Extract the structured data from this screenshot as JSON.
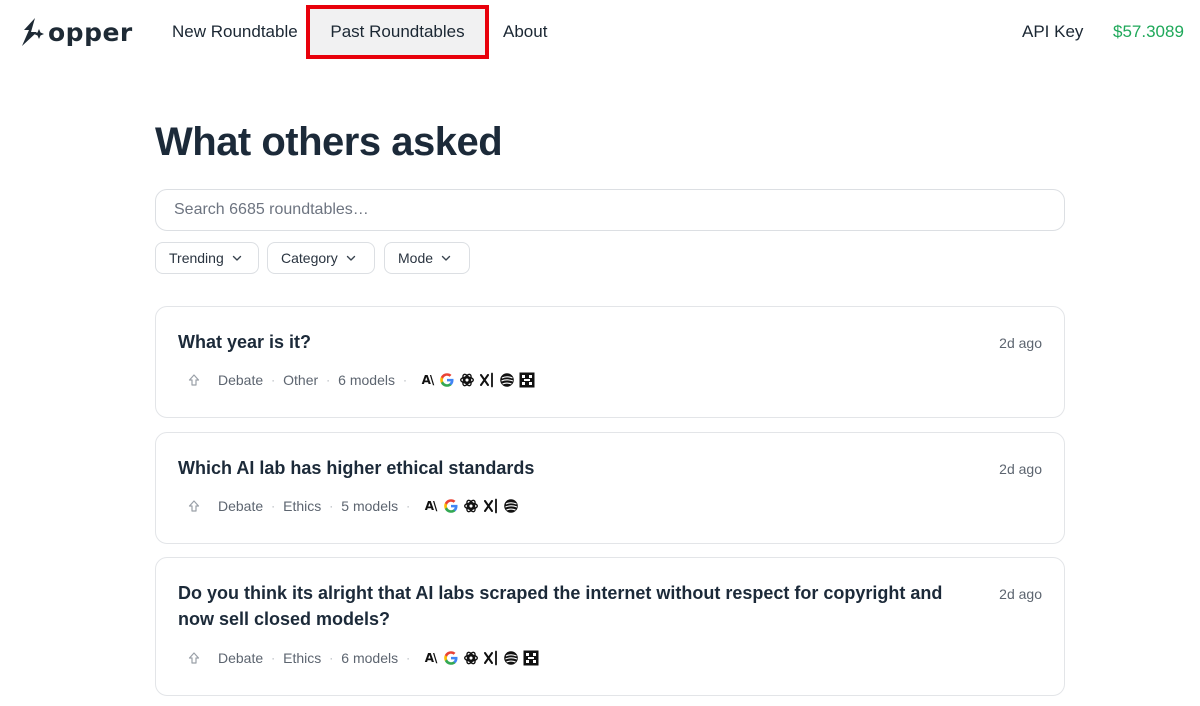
{
  "header": {
    "logo_text": "opper",
    "nav": {
      "new_roundtable": "New Roundtable",
      "past_roundtables": "Past Roundtables",
      "about": "About"
    },
    "api_key": "API Key",
    "balance": "$57.3089",
    "colors": {
      "balance": "#1fa85a",
      "highlight_border": "#e8000b"
    }
  },
  "main": {
    "title": "What others asked",
    "search": {
      "placeholder": "Search 6685 roundtables…",
      "value": ""
    },
    "filters": [
      {
        "label": "Trending",
        "icon": "chevron-down-icon"
      },
      {
        "label": "Category",
        "icon": "chevron-down-icon"
      },
      {
        "label": "Mode",
        "icon": "chevron-down-icon"
      }
    ],
    "roundtables": [
      {
        "question": "What year is it?",
        "time": "2d ago",
        "mode": "Debate",
        "category": "Other",
        "models_count": "6 models",
        "models": [
          "anthropic-icon",
          "google-icon",
          "openai-icon",
          "xai-icon",
          "deepseek-icon",
          "mistral-icon"
        ]
      },
      {
        "question": "Which AI lab has higher ethical standards",
        "time": "2d ago",
        "mode": "Debate",
        "category": "Ethics",
        "models_count": "5 models",
        "models": [
          "anthropic-icon",
          "google-icon",
          "openai-icon",
          "xai-icon",
          "deepseek-icon"
        ]
      },
      {
        "question": "Do you think its alright that AI labs scraped the internet without respect for copyright and now sell closed models?",
        "time": "2d ago",
        "mode": "Debate",
        "category": "Ethics",
        "models_count": "6 models",
        "models": [
          "anthropic-icon",
          "google-icon",
          "openai-icon",
          "xai-icon",
          "deepseek-icon",
          "mistral-icon"
        ]
      }
    ]
  }
}
